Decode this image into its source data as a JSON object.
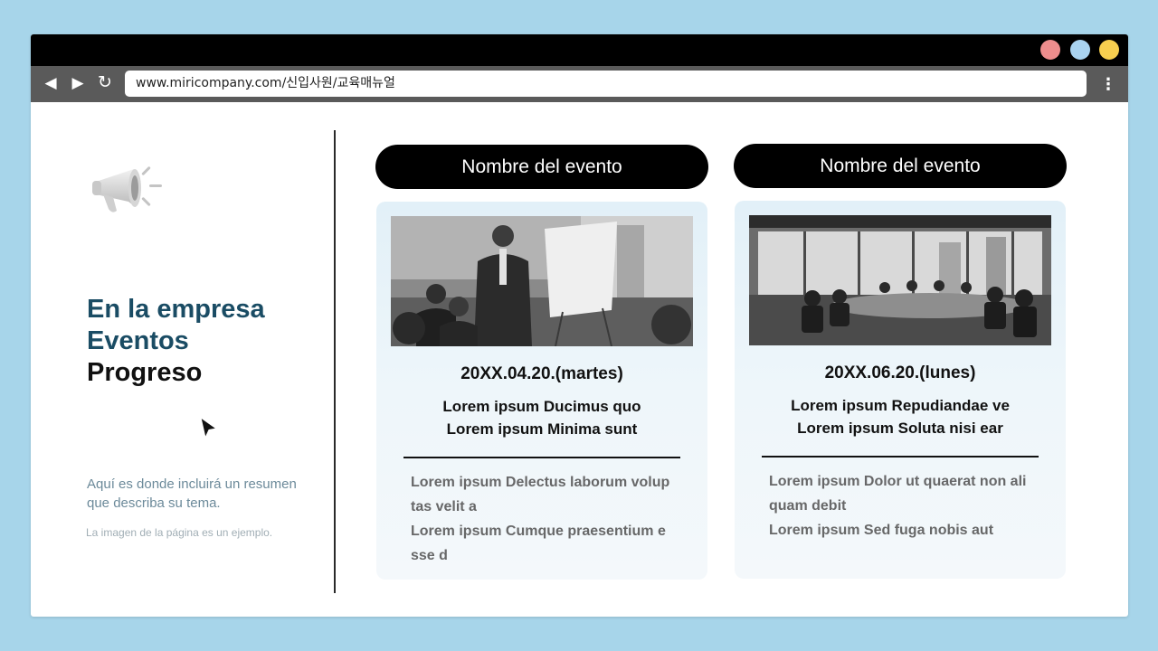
{
  "browser": {
    "url": "www.miricompany.com/신입사원/교육매뉴얼",
    "back_icon": "◀",
    "forward_icon": "▶",
    "reload_icon": "↻",
    "menu_icon": "⋮",
    "traffic_lights": [
      "#ee8d8d",
      "#a9d3f0",
      "#f7cf4f"
    ]
  },
  "left_panel": {
    "heading": [
      "En la empresa",
      "Eventos",
      "Progreso"
    ],
    "summary": "Aquí es donde incluirá un resumen que describa su tema.",
    "note": "La imagen de la página es un ejemplo."
  },
  "events": [
    {
      "name": "Nombre del evento",
      "date": "20XX.04.20.(martes)",
      "title_lines": [
        "Lorem ipsum Ducimus quo",
        "Lorem ipsum Minima sunt"
      ],
      "body_lines": [
        "Lorem ipsum Delectus laborum volup",
        "tas velit a",
        "Lorem ipsum Cumque praesentium e",
        "sse d"
      ]
    },
    {
      "name": "Nombre del evento",
      "date": "20XX.06.20.(lunes)",
      "title_lines": [
        "Lorem ipsum Repudiandae ve",
        "Lorem ipsum Soluta nisi ear"
      ],
      "body_lines": [
        "Lorem ipsum Dolor ut quaerat non ali",
        "quam debit",
        "Lorem ipsum Sed fuga nobis aut"
      ]
    }
  ],
  "colors": {
    "background": "#a7d5ea",
    "heading_accent": "#1a4c64",
    "card_bg": "#e8f3f9"
  }
}
